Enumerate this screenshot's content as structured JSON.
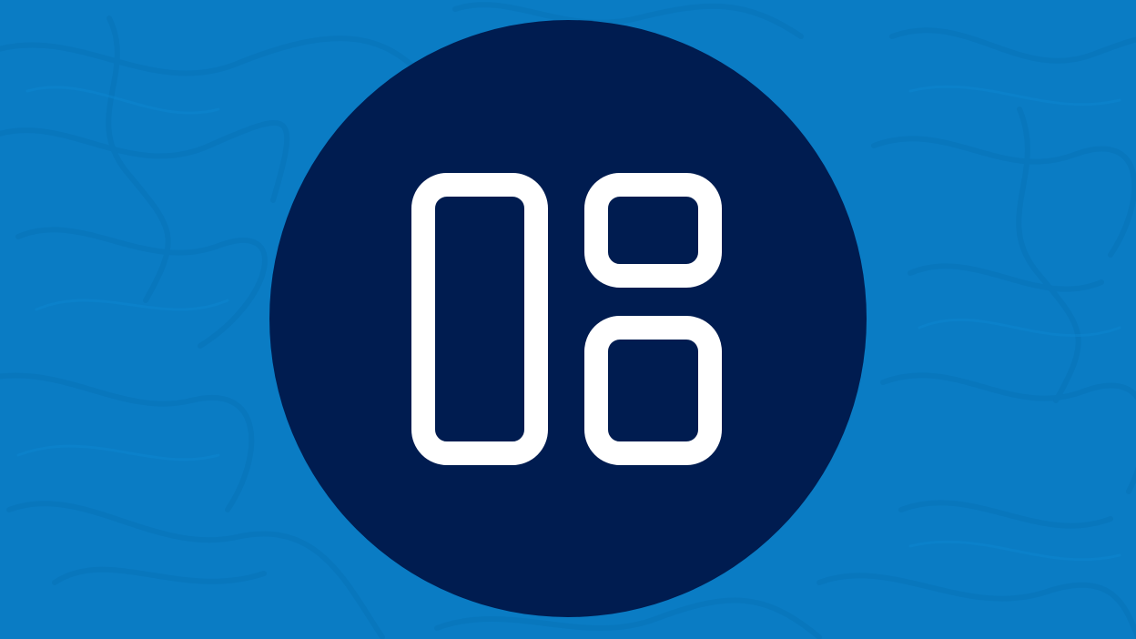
{
  "colors": {
    "background": "#0a7cc4",
    "background_texture": "#0873b8",
    "badge": "#001c50",
    "icon_stroke": "#ffffff"
  },
  "icons": {
    "center_icon": "layout-grid-icon"
  }
}
